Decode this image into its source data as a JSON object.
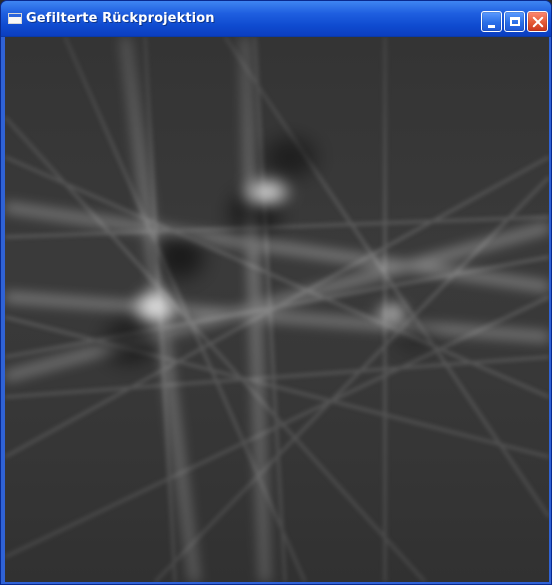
{
  "window": {
    "title": "Gefilterte Rückprojektion",
    "icon": "window-icon",
    "controls": {
      "minimize_icon": "minimize-icon",
      "maximize_icon": "maximize-icon",
      "close_icon": "close-icon"
    }
  },
  "reconstruction": {
    "content": "CT filtered back projection image (grayscale)",
    "colors": {
      "background": "#3a3a3a",
      "streak": "#ffffff",
      "dark": "#000000"
    },
    "bright_spots": 3
  }
}
